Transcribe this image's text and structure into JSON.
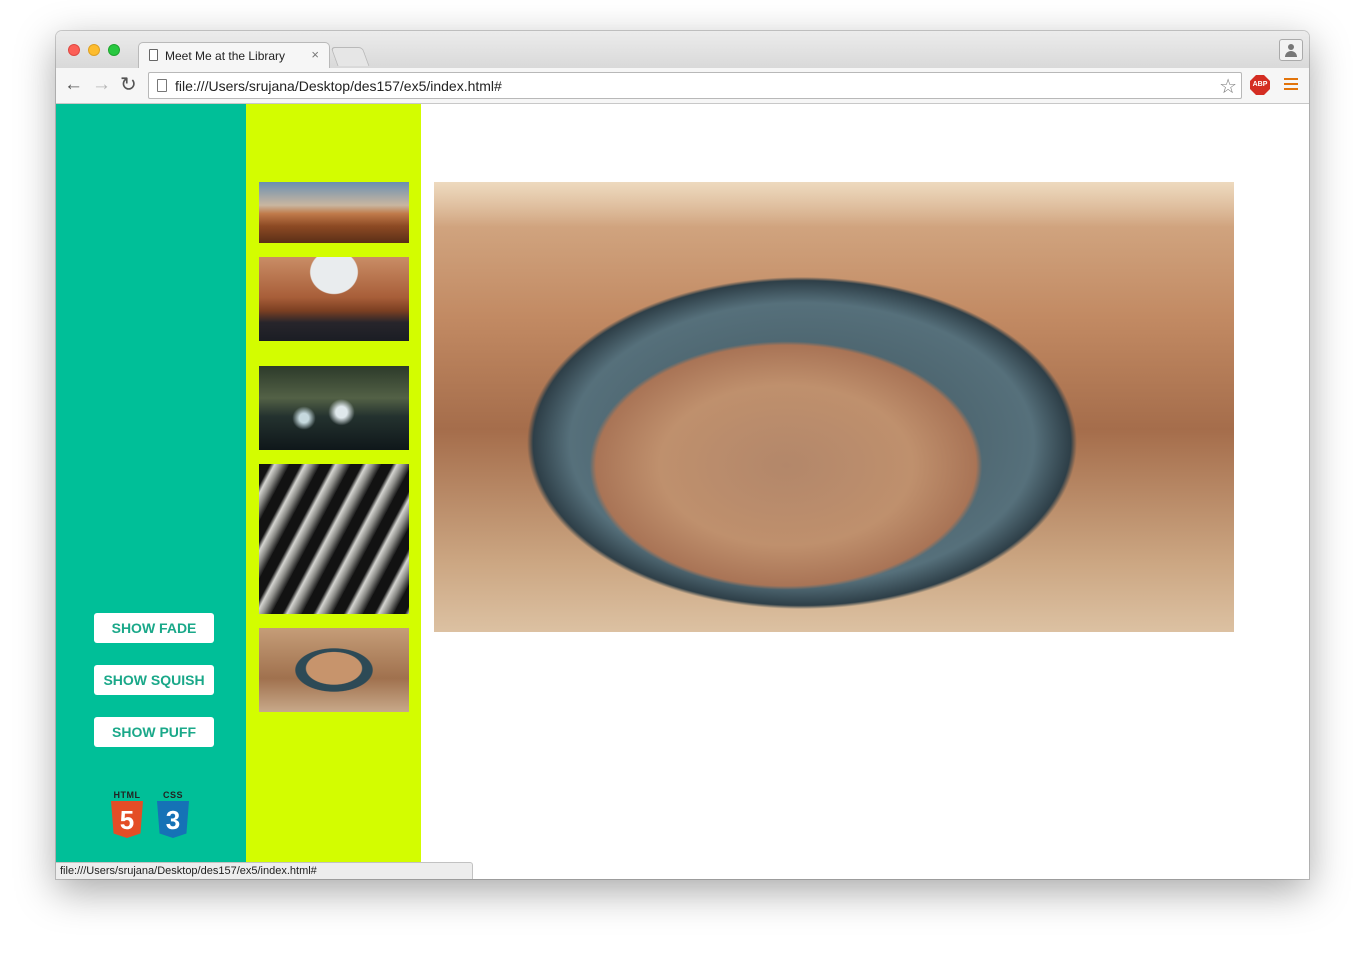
{
  "browser": {
    "tab_title": "Meet Me at the Library",
    "tab_close": "×",
    "url": "file:///Users/srujana/Desktop/des157/ex5/index.html#",
    "status_url": "file:///Users/srujana/Desktop/des157/ex5/index.html#",
    "abp_label": "ABP",
    "icons": {
      "back": "←",
      "forward": "→",
      "reload": "↻",
      "bookmark": "☆"
    }
  },
  "page": {
    "buttons": {
      "fade": "SHOW FADE",
      "squish": "SHOW SQUISH",
      "puff": "SHOW PUFF"
    },
    "badges": {
      "html_label": "HTML",
      "html_number": "5",
      "css_label": "CSS",
      "css_number": "3"
    },
    "colors": {
      "left_panel": "#00bf98",
      "thumb_panel": "#d3fd00",
      "button_text": "#1aa889"
    },
    "thumbnails": [
      "desert-sunset",
      "canyon-lake",
      "night-pool",
      "slot-canyon",
      "horseshoe-bend"
    ],
    "main_image": "horseshoe-bend"
  }
}
